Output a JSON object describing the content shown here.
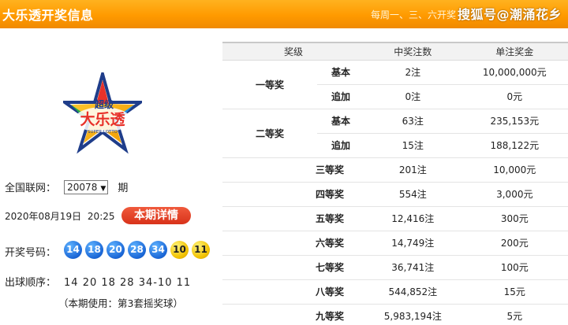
{
  "header": {
    "title": "大乐透开奖信息",
    "schedule": "每周一、三、六开奖",
    "watermark": "搜狐号@潮涌花乡"
  },
  "logo": {
    "top_text": "超级",
    "main_text": "大乐透",
    "sub_text": "SUPER LOTTO"
  },
  "issue": {
    "label": "全国联网：",
    "value": "20078",
    "suffix": "期"
  },
  "draw_time": {
    "date": "2020年08月19日",
    "time": "20:25"
  },
  "detail_button": "本期详情",
  "numbers": {
    "label": "开奖号码：",
    "front": [
      "14",
      "18",
      "20",
      "28",
      "34"
    ],
    "back": [
      "10",
      "11"
    ]
  },
  "order": {
    "label": "出球顺序：",
    "sequence": "14 20 18 28 34-10 11"
  },
  "note": "（本期使用：第3套摇奖球）",
  "table": {
    "headers": [
      "奖级",
      "中奖注数",
      "单注奖金"
    ],
    "rows": [
      {
        "level": "一等奖",
        "sub": "基本",
        "count": "2注",
        "amount": "10,000,000元"
      },
      {
        "level": "",
        "sub": "追加",
        "count": "0注",
        "amount": "0元"
      },
      {
        "level": "二等奖",
        "sub": "基本",
        "count": "63注",
        "amount": "235,153元"
      },
      {
        "level": "",
        "sub": "追加",
        "count": "15注",
        "amount": "188,122元"
      },
      {
        "level": "三等奖",
        "sub": "",
        "count": "201注",
        "amount": "10,000元"
      },
      {
        "level": "四等奖",
        "sub": "",
        "count": "554注",
        "amount": "3,000元"
      },
      {
        "level": "五等奖",
        "sub": "",
        "count": "12,416注",
        "amount": "300元"
      },
      {
        "level": "六等奖",
        "sub": "",
        "count": "14,749注",
        "amount": "200元"
      },
      {
        "level": "七等奖",
        "sub": "",
        "count": "36,741注",
        "amount": "100元"
      },
      {
        "level": "八等奖",
        "sub": "",
        "count": "544,852注",
        "amount": "15元"
      },
      {
        "level": "九等奖",
        "sub": "",
        "count": "5,983,194注",
        "amount": "5元"
      }
    ]
  },
  "colors": {
    "header_orange": "#ff9a00",
    "blue_ball": "#1a66d6",
    "gold_ball": "#f2c200",
    "button_red": "#d8321a"
  }
}
